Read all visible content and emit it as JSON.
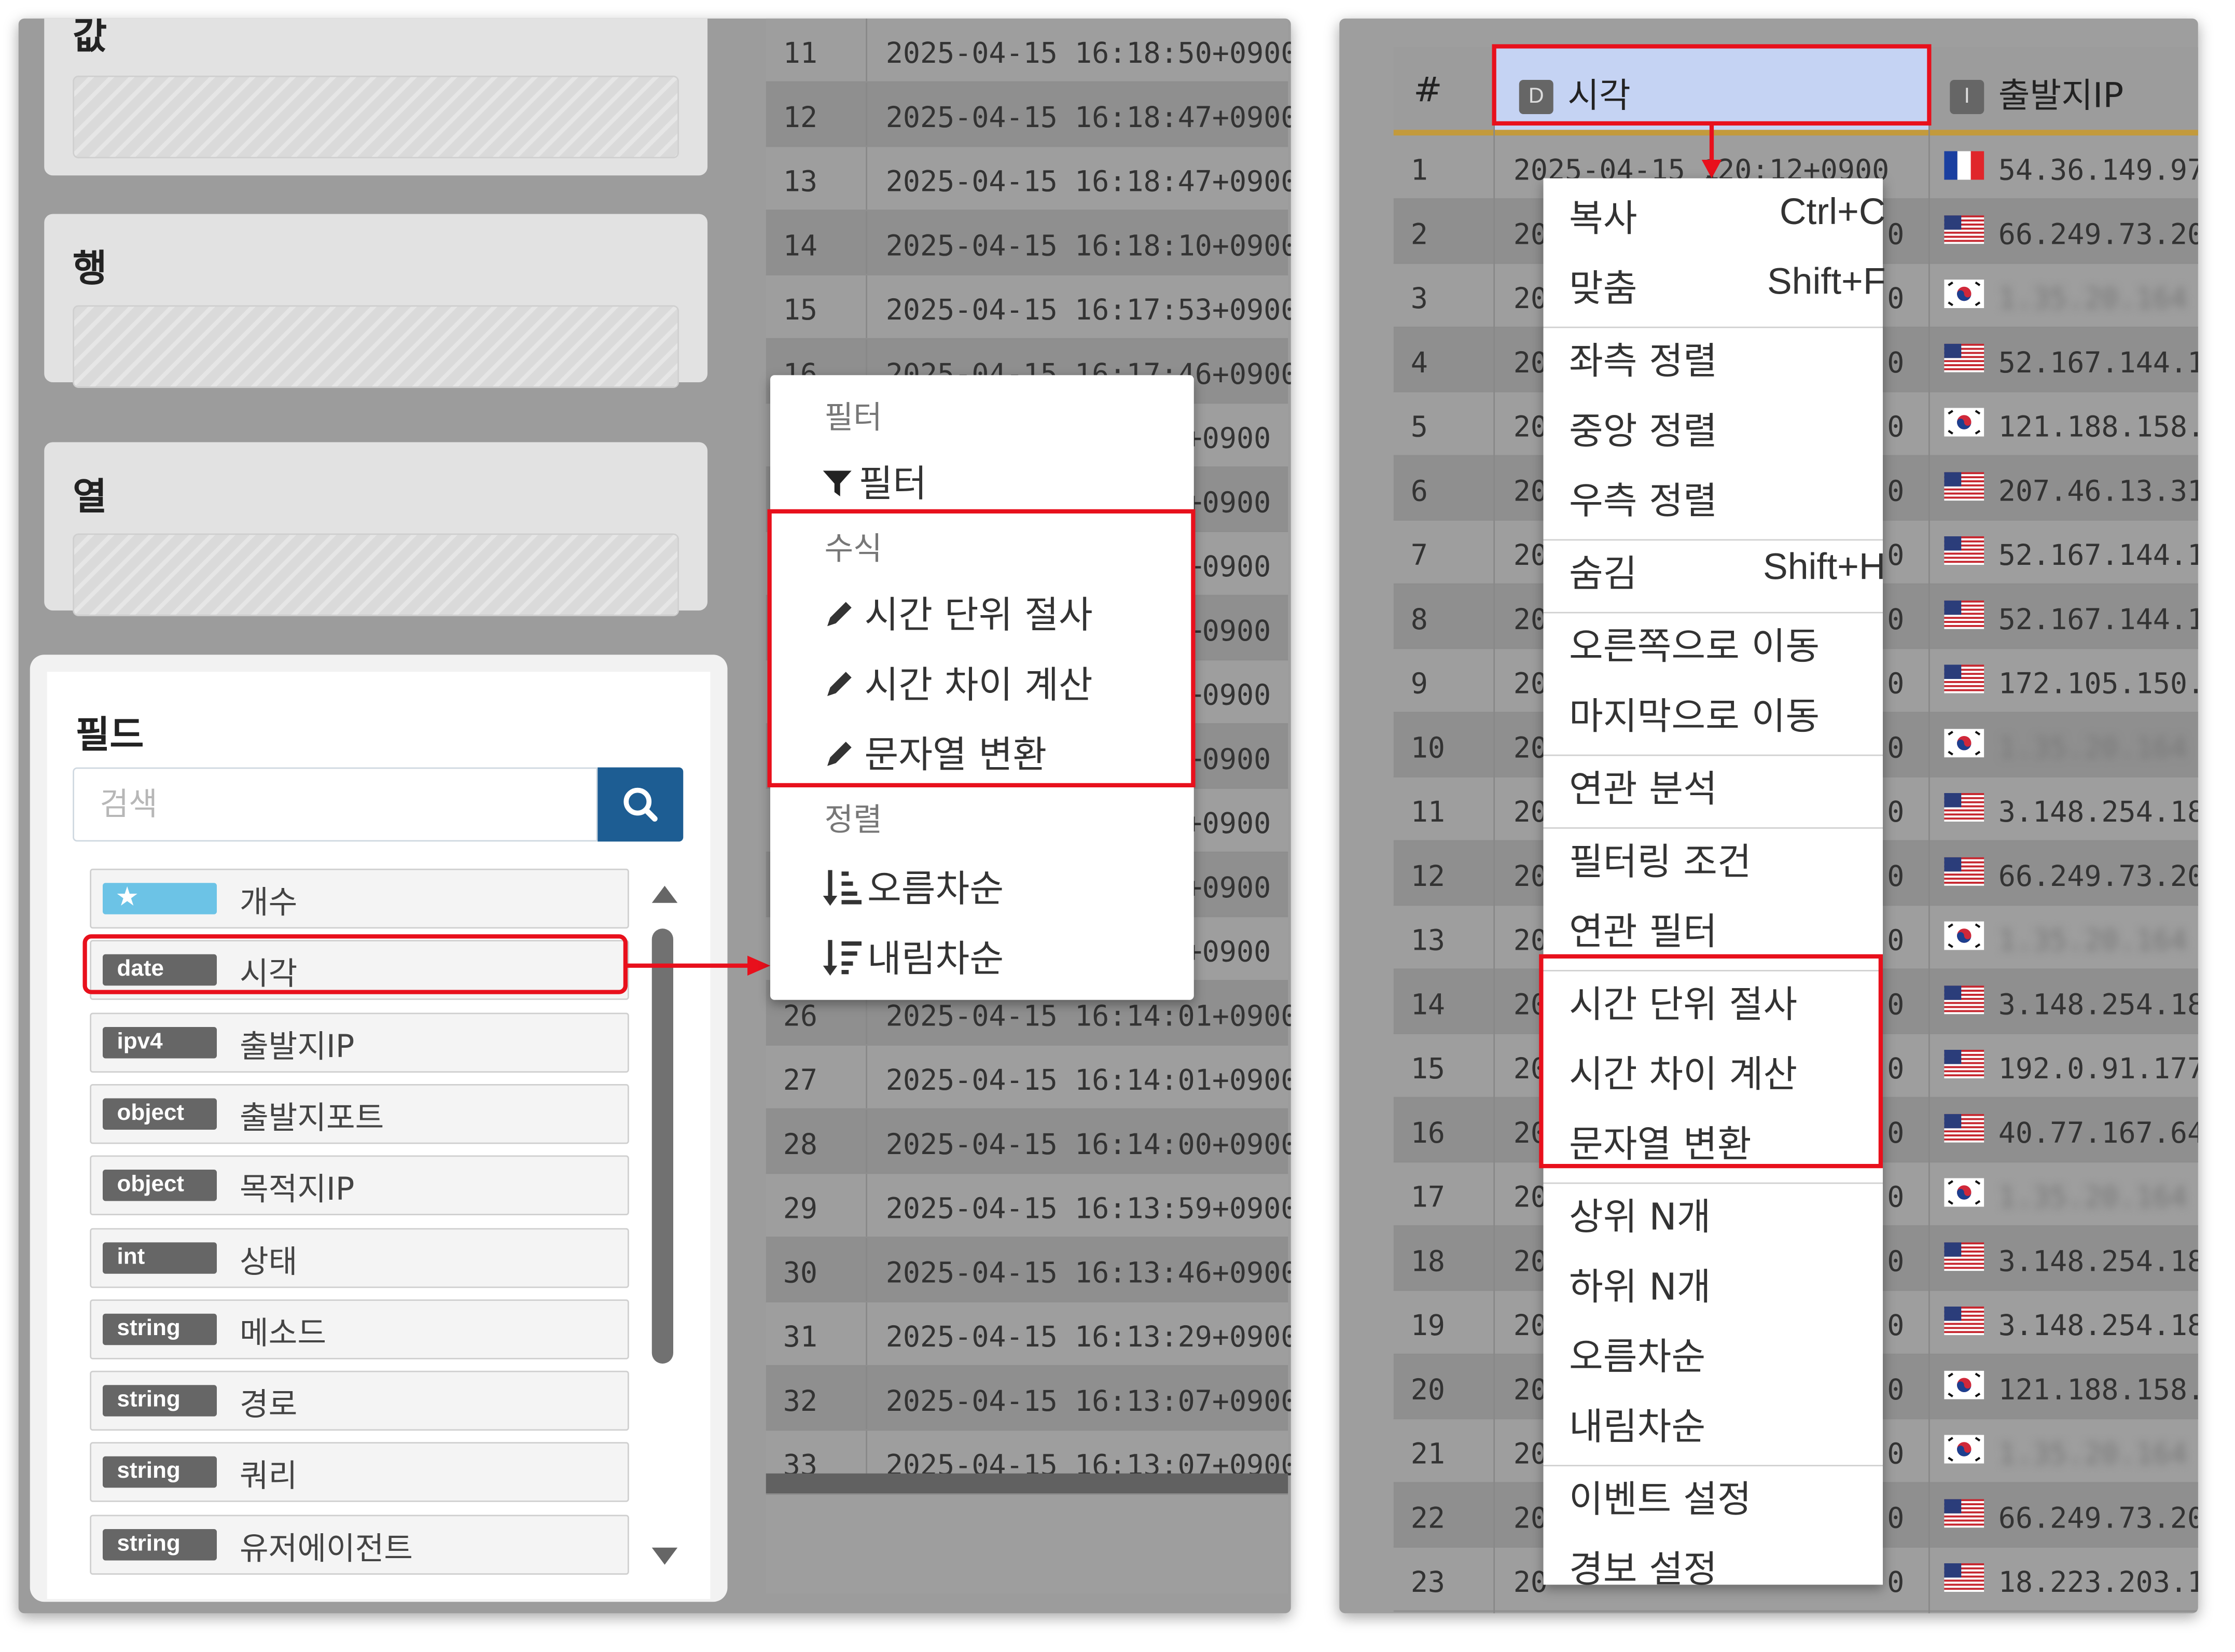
{
  "left": {
    "sections": [
      {
        "title": "값"
      },
      {
        "title": "행"
      },
      {
        "title": "열"
      }
    ],
    "fields": {
      "title": "필드",
      "search_placeholder": "검색",
      "items": [
        {
          "type": "★",
          "label": "개수"
        },
        {
          "type": "date",
          "label": "시각"
        },
        {
          "type": "ipv4",
          "label": "출발지IP"
        },
        {
          "type": "object",
          "label": "출발지포트"
        },
        {
          "type": "object",
          "label": "목적지IP"
        },
        {
          "type": "int",
          "label": "상태"
        },
        {
          "type": "string",
          "label": "메소드"
        },
        {
          "type": "string",
          "label": "경로"
        },
        {
          "type": "string",
          "label": "쿼리"
        },
        {
          "type": "string",
          "label": "유저에이전트"
        }
      ]
    },
    "grid_rows": [
      {
        "num": "11",
        "time": "2025-04-15 16:18:50+0900"
      },
      {
        "num": "12",
        "time": "2025-04-15 16:18:47+0900"
      },
      {
        "num": "13",
        "time": "2025-04-15 16:18:47+0900"
      },
      {
        "num": "14",
        "time": "2025-04-15 16:18:10+0900"
      },
      {
        "num": "15",
        "time": "2025-04-15 16:17:53+0900"
      },
      {
        "num": "16",
        "time": "2025-04-15 16:17:46+0900"
      },
      {
        "num": "",
        "time": "+0900"
      },
      {
        "num": "",
        "time": "+0900"
      },
      {
        "num": "",
        "time": "+0900"
      },
      {
        "num": "",
        "time": "+0900"
      },
      {
        "num": "",
        "time": "+0900"
      },
      {
        "num": "",
        "time": "+0900"
      },
      {
        "num": "",
        "time": "+0900"
      },
      {
        "num": "",
        "time": "+0900"
      },
      {
        "num": "",
        "time": "+0900"
      },
      {
        "num": "26",
        "time": "2025-04-15 16:14:01+0900"
      },
      {
        "num": "27",
        "time": "2025-04-15 16:14:01+0900"
      },
      {
        "num": "28",
        "time": "2025-04-15 16:14:00+0900"
      },
      {
        "num": "29",
        "time": "2025-04-15 16:13:59+0900"
      },
      {
        "num": "30",
        "time": "2025-04-15 16:13:46+0900"
      },
      {
        "num": "31",
        "time": "2025-04-15 16:13:29+0900"
      },
      {
        "num": "32",
        "time": "2025-04-15 16:13:07+0900"
      },
      {
        "num": "33",
        "time": "2025-04-15 16:13:07+0900"
      }
    ],
    "context_menu": {
      "filter_header": "필터",
      "filter_item": "필터",
      "formula_header": "수식",
      "formula_items": [
        "시간 단위 절사",
        "시간 차이 계산",
        "문자열 변환"
      ],
      "sort_header": "정렬",
      "sort_asc": "오름차순",
      "sort_desc": "내림차순"
    }
  },
  "right": {
    "columns": {
      "num": "#",
      "time_badge": "D",
      "time": "시각",
      "ip_badge": "I",
      "ip": "출발지IP"
    },
    "rows": [
      {
        "num": "1",
        "date": "2025-04-15 1",
        "z": ":20:12+0900",
        "flag": "fr",
        "ip": "54.36.149.97"
      },
      {
        "num": "2",
        "date": "20",
        "z": "0",
        "flag": "us",
        "ip": "66.249.73.20"
      },
      {
        "num": "3",
        "date": "20",
        "z": "0",
        "flag": "kr",
        "ip": "1.35.20.164"
      },
      {
        "num": "4",
        "date": "20",
        "z": "0",
        "flag": "us",
        "ip": "52.167.144.1"
      },
      {
        "num": "5",
        "date": "20",
        "z": "0",
        "flag": "kr",
        "ip": "121.188.158."
      },
      {
        "num": "6",
        "date": "20",
        "z": "0",
        "flag": "us",
        "ip": "207.46.13.31"
      },
      {
        "num": "7",
        "date": "20",
        "z": "0",
        "flag": "us",
        "ip": "52.167.144.1"
      },
      {
        "num": "8",
        "date": "20",
        "z": "0",
        "flag": "us",
        "ip": "52.167.144.1"
      },
      {
        "num": "9",
        "date": "20",
        "z": "0",
        "flag": "us",
        "ip": "172.105.150."
      },
      {
        "num": "10",
        "date": "20",
        "z": "0",
        "flag": "kr",
        "ip": "1.35.20.164"
      },
      {
        "num": "11",
        "date": "20",
        "z": "0",
        "flag": "us",
        "ip": "3.148.254.18"
      },
      {
        "num": "12",
        "date": "20",
        "z": "0",
        "flag": "us",
        "ip": "66.249.73.20"
      },
      {
        "num": "13",
        "date": "20",
        "z": "0",
        "flag": "kr",
        "ip": "1.35.20.164"
      },
      {
        "num": "14",
        "date": "20",
        "z": "0",
        "flag": "us",
        "ip": "3.148.254.18"
      },
      {
        "num": "15",
        "date": "20",
        "z": "0",
        "flag": "us",
        "ip": "192.0.91.177"
      },
      {
        "num": "16",
        "date": "20",
        "z": "0",
        "flag": "us",
        "ip": "40.77.167.64"
      },
      {
        "num": "17",
        "date": "20",
        "z": "0",
        "flag": "kr",
        "ip": "1.35.20.164"
      },
      {
        "num": "18",
        "date": "20",
        "z": "0",
        "flag": "us",
        "ip": "3.148.254.18"
      },
      {
        "num": "19",
        "date": "20",
        "z": "0",
        "flag": "us",
        "ip": "3.148.254.18"
      },
      {
        "num": "20",
        "date": "20",
        "z": "0",
        "flag": "kr",
        "ip": "121.188.158."
      },
      {
        "num": "21",
        "date": "20",
        "z": "0",
        "flag": "kr",
        "ip": "1.35.20.164"
      },
      {
        "num": "22",
        "date": "20",
        "z": "0",
        "flag": "us",
        "ip": "66.249.73.20"
      },
      {
        "num": "23",
        "date": "20",
        "z": "0",
        "flag": "us",
        "ip": "18.223.203.1"
      }
    ],
    "blurred_rows": [
      3,
      10,
      13,
      17,
      21
    ],
    "context_menu": [
      {
        "label": "복사",
        "shortcut": "Ctrl+C"
      },
      {
        "label": "맞춤",
        "shortcut": "Shift+F",
        "sep_after": true
      },
      {
        "label": "좌측 정렬"
      },
      {
        "label": "중앙 정렬"
      },
      {
        "label": "우측 정렬",
        "sep_after": true
      },
      {
        "label": "숨김",
        "shortcut": "Shift+H",
        "sep_after": true
      },
      {
        "label": "오른쪽으로 이동"
      },
      {
        "label": "마지막으로 이동",
        "sep_after": true
      },
      {
        "label": "연관 분석",
        "sep_after": true
      },
      {
        "label": "필터링 조건"
      },
      {
        "label": "연관 필터",
        "sep_after": true
      },
      {
        "label": "시간 단위 절사"
      },
      {
        "label": "시간 차이 계산"
      },
      {
        "label": "문자열 변환",
        "sep_after": true
      },
      {
        "label": "상위 N개"
      },
      {
        "label": "하위 N개"
      },
      {
        "label": "오름차순"
      },
      {
        "label": "내림차순",
        "sep_after": true
      },
      {
        "label": "이벤트 설정"
      },
      {
        "label": "경보 설정"
      }
    ]
  },
  "colors": {
    "highlight": "#e8101c",
    "search_button": "#1d5d93",
    "header_selected": "#c5d3f3"
  }
}
